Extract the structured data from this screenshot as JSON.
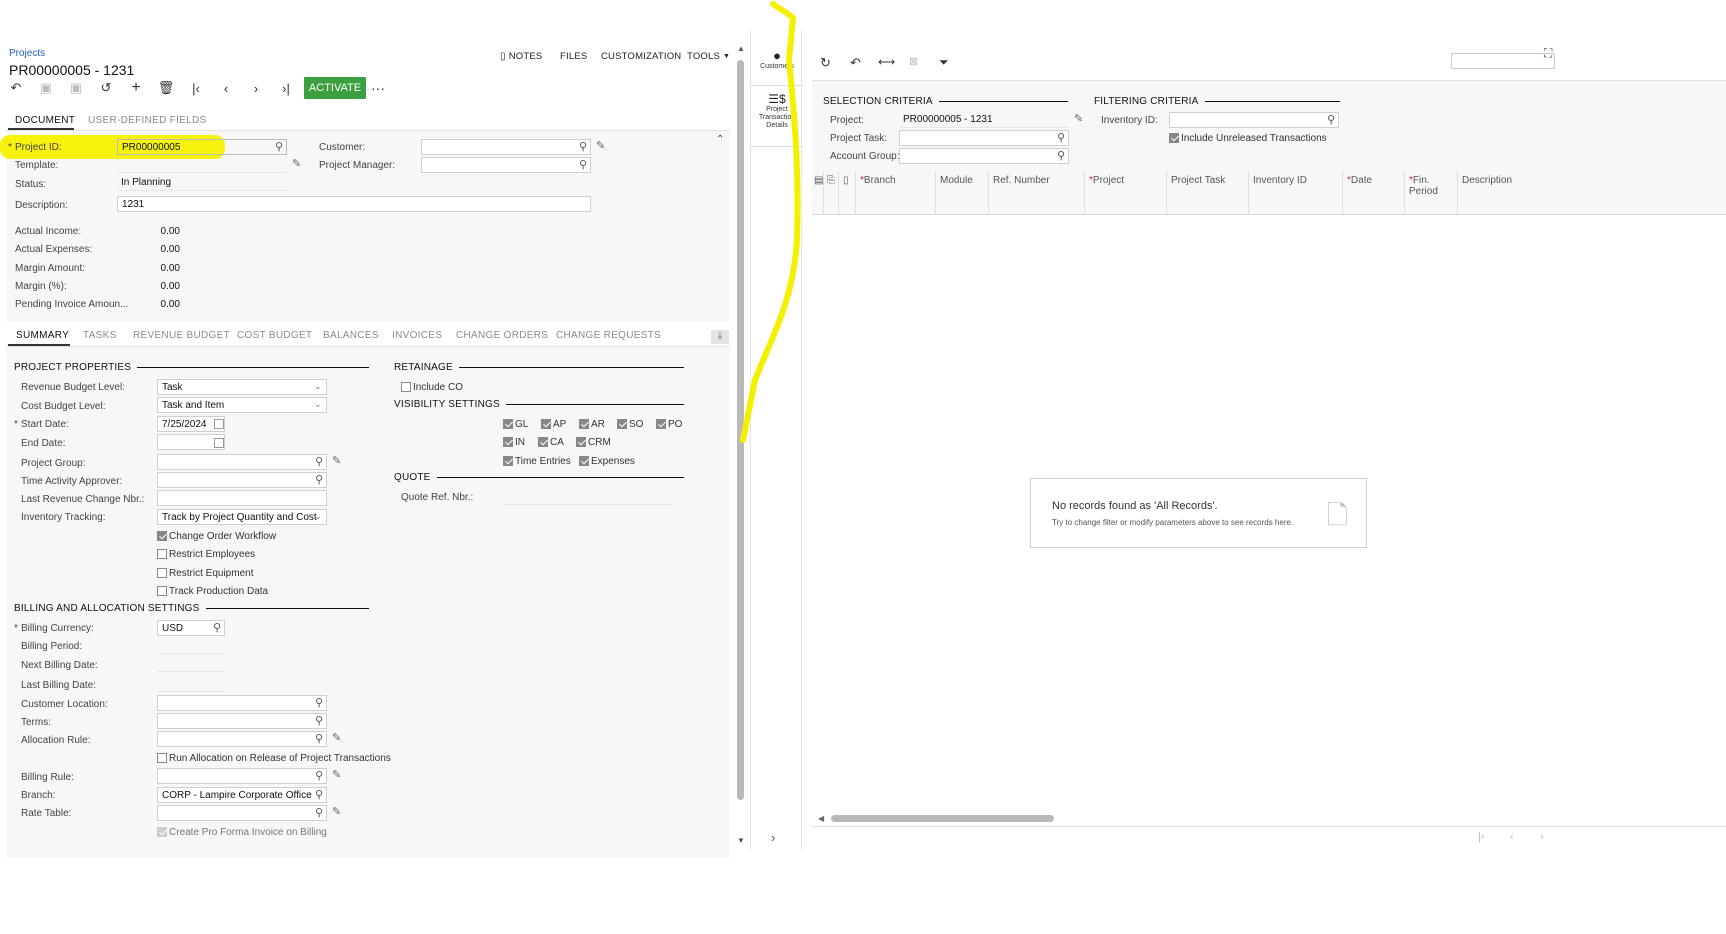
{
  "breadcrumb": "Projects",
  "page_title": "PR00000005 - 1231",
  "top_actions": [
    "NOTES",
    "FILES",
    "CUSTOMIZATION",
    "TOOLS"
  ],
  "activate_label": "ACTIVATE",
  "more_label": "···",
  "doc_tabs": [
    "DOCUMENT",
    "USER-DEFINED FIELDS"
  ],
  "header_form": {
    "project_id_label": "Project ID:",
    "project_id_value": "PR00000005",
    "template_label": "Template:",
    "status_label": "Status:",
    "status_value": "In Planning",
    "description_label": "Description:",
    "description_value": "1231",
    "customer_label": "Customer:",
    "project_manager_label": "Project Manager:",
    "actual_income_label": "Actual Income:",
    "actual_income_value": "0.00",
    "actual_expenses_label": "Actual Expenses:",
    "actual_expenses_value": "0.00",
    "margin_amount_label": "Margin Amount:",
    "margin_amount_value": "0.00",
    "margin_pct_label": "Margin (%):",
    "margin_pct_value": "0.00",
    "pending_invoice_label": "Pending Invoice Amoun...",
    "pending_invoice_value": "0.00"
  },
  "summary_tabs": [
    "SUMMARY",
    "TASKS",
    "REVENUE BUDGET",
    "COST BUDGET",
    "BALANCES",
    "INVOICES",
    "CHANGE ORDERS",
    "CHANGE REQUESTS"
  ],
  "project_properties": {
    "title": "PROJECT PROPERTIES",
    "revenue_budget_level_label": "Revenue Budget Level:",
    "revenue_budget_level_value": "Task",
    "cost_budget_level_label": "Cost Budget Level:",
    "cost_budget_level_value": "Task and Item",
    "start_date_label": "Start Date:",
    "start_date_value": "7/25/2024",
    "end_date_label": "End Date:",
    "project_group_label": "Project Group:",
    "time_activity_approver_label": "Time Activity Approver:",
    "last_revenue_change_label": "Last Revenue Change Nbr.:",
    "inventory_tracking_label": "Inventory Tracking:",
    "inventory_tracking_value": "Track by Project Quantity and Cost",
    "change_order_workflow": "Change Order Workflow",
    "restrict_employees": "Restrict Employees",
    "restrict_equipment": "Restrict Equipment",
    "track_production_data": "Track Production Data"
  },
  "billing": {
    "title": "BILLING AND ALLOCATION SETTINGS",
    "billing_currency_label": "Billing Currency:",
    "billing_currency_value": "USD",
    "billing_period_label": "Billing Period:",
    "next_billing_date_label": "Next Billing Date:",
    "last_billing_date_label": "Last Billing Date:",
    "customer_location_label": "Customer Location:",
    "terms_label": "Terms:",
    "allocation_rule_label": "Allocation Rule:",
    "run_allocation": "Run Allocation on Release of Project Transactions",
    "billing_rule_label": "Billing Rule:",
    "branch_label": "Branch:",
    "branch_value": "CORP - Lampire Corporate Office",
    "rate_table_label": "Rate Table:",
    "create_pro_forma": "Create Pro Forma Invoice on Billing"
  },
  "retainage": {
    "title": "RETAINAGE",
    "include_co": "Include CO"
  },
  "visibility": {
    "title": "VISIBILITY SETTINGS",
    "items": [
      "GL",
      "AP",
      "AR",
      "SO",
      "PO",
      "IN",
      "CA",
      "CRM",
      "Time Entries",
      "Expenses"
    ]
  },
  "quote": {
    "title": "QUOTE",
    "quote_ref_label": "Quote Ref. Nbr.:"
  },
  "rail": {
    "customers": "Customers",
    "ptd": "Project Transaction Details"
  },
  "selection": {
    "title": "SELECTION CRITERIA",
    "project_label": "Project:",
    "project_value": "PR00000005 - 1231",
    "project_task_label": "Project Task:",
    "account_group_label": "Account Group:"
  },
  "filtering": {
    "title": "FILTERING CRITERIA",
    "inventory_id_label": "Inventory ID:",
    "include_unreleased": "Include Unreleased Transactions"
  },
  "grid_columns": [
    "Branch",
    "Module",
    "Ref. Number",
    "Project",
    "Project Task",
    "Inventory ID",
    "Date",
    "Fin. Period",
    "Description"
  ],
  "empty": {
    "title": "No records found as 'All Records'.",
    "hint": "Try to change filter or modify parameters above to see records here."
  },
  "colors": {
    "accent": "#3c9f40",
    "link": "#1f5fc5",
    "highlight": "#f5f000"
  }
}
